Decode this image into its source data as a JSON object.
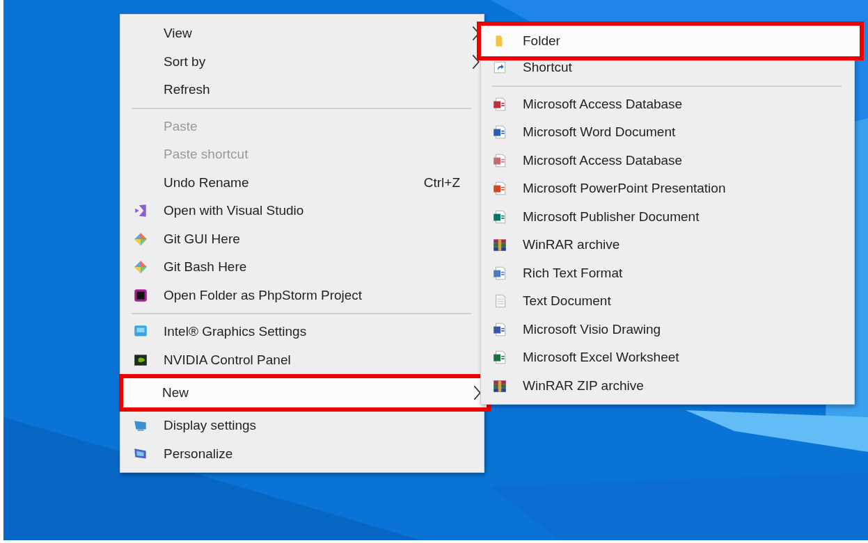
{
  "context_menu": {
    "groups": [
      [
        {
          "label": "View",
          "submenu": true,
          "disabled": false,
          "highlighted": false
        },
        {
          "label": "Sort by",
          "submenu": true,
          "disabled": false,
          "highlighted": false
        },
        {
          "label": "Refresh",
          "submenu": false,
          "disabled": false,
          "highlighted": false
        }
      ],
      [
        {
          "label": "Paste",
          "submenu": false,
          "disabled": true,
          "highlighted": false
        },
        {
          "label": "Paste shortcut",
          "submenu": false,
          "disabled": true,
          "highlighted": false
        },
        {
          "label": "Undo Rename",
          "shortcut": "Ctrl+Z",
          "submenu": false,
          "disabled": false,
          "highlighted": false
        },
        {
          "label": "Open with Visual Studio",
          "kind": "vs",
          "submenu": false,
          "disabled": false,
          "highlighted": false
        },
        {
          "label": "Git GUI Here",
          "kind": "git",
          "submenu": false,
          "disabled": false,
          "highlighted": false
        },
        {
          "label": "Git Bash Here",
          "kind": "git",
          "submenu": false,
          "disabled": false,
          "highlighted": false
        },
        {
          "label": "Open Folder as PhpStorm Project",
          "kind": "phpstorm",
          "submenu": false,
          "disabled": false,
          "highlighted": false
        }
      ],
      [
        {
          "label": "Intel® Graphics Settings",
          "kind": "intel",
          "submenu": false,
          "disabled": false,
          "highlighted": false
        },
        {
          "label": "NVIDIA Control Panel",
          "kind": "nvidia",
          "submenu": false,
          "disabled": false,
          "highlighted": false
        },
        {
          "label": "New",
          "submenu": true,
          "disabled": false,
          "highlighted": true
        },
        {
          "label": "Display settings",
          "kind": "display",
          "submenu": false,
          "disabled": false,
          "highlighted": false
        },
        {
          "label": "Personalize",
          "kind": "personalize",
          "submenu": false,
          "disabled": false,
          "highlighted": false
        }
      ]
    ]
  },
  "new_submenu": {
    "groups": [
      [
        {
          "label": "Folder",
          "kind": "folder",
          "highlighted": true
        },
        {
          "label": "Shortcut",
          "kind": "shortcut",
          "highlighted": false
        }
      ],
      [
        {
          "label": "Microsoft Access Database",
          "kind": "document",
          "color": "#b7323c",
          "highlighted": false
        },
        {
          "label": "Microsoft Word Document",
          "kind": "document",
          "color": "#2b5fb4",
          "highlighted": false
        },
        {
          "label": "Microsoft Access Database",
          "kind": "document",
          "color": "#c76a72",
          "highlighted": false
        },
        {
          "label": "Microsoft PowerPoint Presentation",
          "kind": "document",
          "color": "#d24726",
          "highlighted": false
        },
        {
          "label": "Microsoft Publisher Document",
          "kind": "document",
          "color": "#077568",
          "highlighted": false
        },
        {
          "label": "WinRAR archive",
          "kind": "archive",
          "highlighted": false
        },
        {
          "label": "Rich Text Format",
          "kind": "document",
          "color": "#4a78c2",
          "highlighted": false
        },
        {
          "label": "Text Document",
          "kind": "text",
          "highlighted": false
        },
        {
          "label": "Microsoft Visio Drawing",
          "kind": "document",
          "color": "#3955a3",
          "highlighted": false
        },
        {
          "label": "Microsoft Excel Worksheet",
          "kind": "document",
          "color": "#1e7145",
          "highlighted": false
        },
        {
          "label": "WinRAR ZIP archive",
          "kind": "archive",
          "highlighted": false
        }
      ]
    ]
  }
}
